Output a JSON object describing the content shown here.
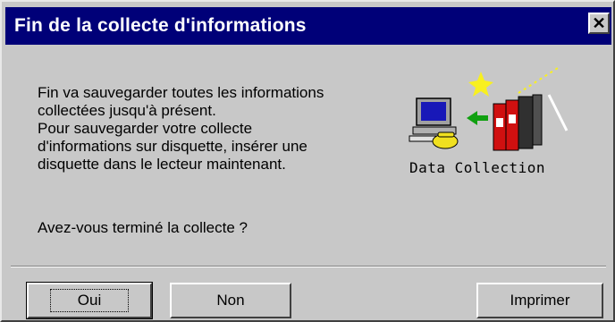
{
  "dialog": {
    "title": "Fin de la collecte d'informations",
    "close_label": "✕",
    "message": "Fin va sauvegarder toutes les informations\ncollectées jusqu'à présent.\n Pour sauvegarder votre collecte\nd'informations sur disquette, insérer une\ndisquette dans le lecteur maintenant.",
    "question": "Avez-vous terminé la collecte ?",
    "icon": {
      "name": "data-collection-icon",
      "caption": "Data Collection"
    }
  },
  "buttons": {
    "yes": "Oui",
    "no": "Non",
    "print": "Imprimer"
  },
  "colors": {
    "titlebar": "#000078",
    "face": "#c8c8c8",
    "binder_red": "#d01010",
    "binder_dark": "#303030",
    "monitor_screen": "#1818b8",
    "phone_yellow": "#f0e020",
    "arrow_green": "#10a010",
    "star_yellow": "#f8f020"
  }
}
